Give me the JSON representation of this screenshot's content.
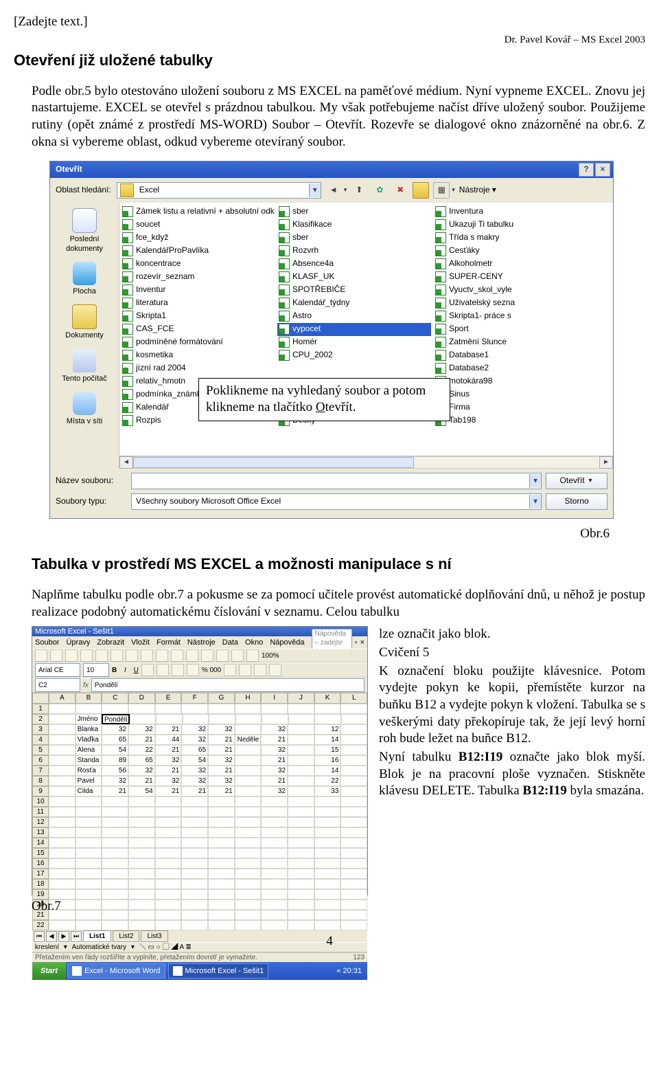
{
  "header": {
    "placeholder": "[Zadejte text.]",
    "author": "Dr. Pavel Kovář – MS Excel 2003"
  },
  "heading1": "Otevření již uložené tabulky",
  "para1": "Podle obr.5 bylo otestováno uložení souboru z MS EXCEL na paměťové médium. Nyní vypneme EXCEL. Znovu jej nastartujeme. EXCEL se otevřel s prázdnou tabulkou. My však potřebujeme načíst dříve uložený soubor. Použijeme rutiny (opět známé z prostředí MS-WORD) Soubor – Otevřít. Rozevře se dialogové okno znázorněné na obr.6. Z okna si vybereme oblast, odkud vybereme otevíraný soubor.",
  "dialog": {
    "title": "Otevřít",
    "searchLabel": "Oblast hledání:",
    "searchValue": "Excel",
    "toolsLabel": "Nástroje",
    "sidebar": [
      {
        "label": "Poslední dokumenty"
      },
      {
        "label": "Plocha"
      },
      {
        "label": "Dokumenty"
      },
      {
        "label": "Tento počítač"
      },
      {
        "label": "Místa v síti"
      }
    ],
    "col1": [
      "Zámek listu a relativní + absolutní odkazování",
      "soucet",
      "fce_když",
      "KalendářProPavlíka",
      "koncentrace",
      "rozevír_seznam",
      "Inventur",
      "literatura",
      "Skripta1",
      "CAS_FCE",
      "podmíněné formátování",
      "kosmetika",
      "jízní rad 2004",
      "relativ_hmotn",
      "podmínka_známky",
      "Kalendář",
      "Rozpis"
    ],
    "col2": [
      "sber",
      "Klasifikace",
      "sber",
      "Rozvrh",
      "Absence4a",
      "KLASF_UK",
      "SPOTŘEBIČE",
      "Kalendář_týdny",
      "Astro",
      "vypocet",
      "Homér",
      "CPU_2002",
      "",
      "",
      "",
      "",
      "Desky"
    ],
    "col2_selected_index": 9,
    "col3": [
      "Inventura",
      "Ukazuji Ti tabulku",
      "Třída s makry",
      "Cesťáky",
      "Alkoholmetr",
      "SUPER-CENY",
      "Vyuctv_skol_vyle",
      "Uživatelský sezna",
      "Skripta1- práce s",
      "Sport",
      "Zatmění Slunce",
      "Database1",
      "Database2",
      "motokára98",
      "Sinus",
      "Firma",
      "Tab198"
    ],
    "callout": "Poklikneme na vyhledaný soubor a potom klikneme na tlačítko Otevřít.",
    "nameLabel": "Název souboru:",
    "nameValue": "",
    "typeLabel": "Soubory typu:",
    "typeValue": "Všechny soubory Microsoft Office Excel",
    "openBtn": "Otevřít",
    "cancelBtn": "Storno"
  },
  "fig6": "Obr.6",
  "heading2": "Tabulka v prostředí MS EXCEL a možnosti manipulace s ní",
  "para2": "Naplňme tabulku podle obr.7 a pokusme se za pomocí učitele provést automatické doplňování dnů, u něhož je postup realizace podobný automatickému číslování v seznamu. Celou tabulku",
  "excel": {
    "title": "Microsoft Excel - Sešit1",
    "menu": [
      "Soubor",
      "Úpravy",
      "Zobrazit",
      "Vložit",
      "Formát",
      "Nástroje",
      "Data",
      "Okno",
      "Nápověda"
    ],
    "help": "Nápověda – zadejte dotaz",
    "font": "Arial CE",
    "size": "10",
    "namebox": "C2",
    "fxval": "Pondělí",
    "cols": [
      "A",
      "B",
      "C",
      "D",
      "E",
      "F",
      "G",
      "H",
      "I",
      "J",
      "K",
      "L"
    ],
    "rows": [
      [
        "",
        "",
        "",
        "",
        "",
        "",
        "",
        "",
        "",
        "",
        "",
        ""
      ],
      [
        "",
        "Jméno",
        "Pondělí",
        "",
        "",
        "",
        "",
        "",
        "",
        "",
        "",
        ""
      ],
      [
        "",
        "Blanka",
        "32",
        "32",
        "21",
        "32",
        "32",
        "",
        "32",
        "",
        "12",
        ""
      ],
      [
        "",
        "Vlaďka",
        "65",
        "21",
        "44",
        "32",
        "21",
        "Neděle",
        "21",
        "",
        "14",
        ""
      ],
      [
        "",
        "Alena",
        "54",
        "22",
        "21",
        "65",
        "21",
        "",
        "32",
        "",
        "15",
        ""
      ],
      [
        "",
        "Standa",
        "89",
        "65",
        "32",
        "54",
        "32",
        "",
        "21",
        "",
        "16",
        ""
      ],
      [
        "",
        "Rosťa",
        "56",
        "32",
        "21",
        "32",
        "21",
        "",
        "32",
        "",
        "14",
        ""
      ],
      [
        "",
        "Pavel",
        "32",
        "21",
        "32",
        "32",
        "32",
        "",
        "21",
        "",
        "22",
        ""
      ],
      [
        "",
        "Cilda",
        "21",
        "54",
        "21",
        "21",
        "21",
        "",
        "32",
        "",
        "33",
        ""
      ],
      [
        "",
        "",
        "",
        "",
        "",
        "",
        "",
        "",
        "",
        "",
        "",
        ""
      ],
      [
        "",
        "",
        "",
        "",
        "",
        "",
        "",
        "",
        "",
        "",
        "",
        ""
      ],
      [
        "",
        "",
        "",
        "",
        "",
        "",
        "",
        "",
        "",
        "",
        "",
        ""
      ],
      [
        "",
        "",
        "",
        "",
        "",
        "",
        "",
        "",
        "",
        "",
        "",
        ""
      ],
      [
        "",
        "",
        "",
        "",
        "",
        "",
        "",
        "",
        "",
        "",
        "",
        ""
      ],
      [
        "",
        "",
        "",
        "",
        "",
        "",
        "",
        "",
        "",
        "",
        "",
        ""
      ],
      [
        "",
        "",
        "",
        "",
        "",
        "",
        "",
        "",
        "",
        "",
        "",
        ""
      ],
      [
        "",
        "",
        "",
        "",
        "",
        "",
        "",
        "",
        "",
        "",
        "",
        ""
      ],
      [
        "",
        "",
        "",
        "",
        "",
        "",
        "",
        "",
        "",
        "",
        "",
        ""
      ],
      [
        "",
        "",
        "",
        "",
        "",
        "",
        "",
        "",
        "",
        "",
        "",
        ""
      ],
      [
        "",
        "",
        "",
        "",
        "",
        "",
        "",
        "",
        "",
        "",
        "",
        ""
      ],
      [
        "",
        "",
        "",
        "",
        "",
        "",
        "",
        "",
        "",
        "",
        "",
        ""
      ],
      [
        "",
        "",
        "",
        "",
        "",
        "",
        "",
        "",
        "",
        "",
        "",
        ""
      ]
    ],
    "sheets": [
      "List1",
      "List2",
      "List3"
    ],
    "draw": "kreslení",
    "autoshapes": "Automatické tvary",
    "status": "Přetažením ven řády rozšíříte a vyplníte, přetažením dovnitř je vymažete.",
    "statval": "123",
    "start": "Start",
    "app1": "Excel - Microsoft Word",
    "app2": "Microsoft Excel - Sešit1",
    "clock": "« 20:31"
  },
  "fig7": "Obr.7",
  "right": "lze označit jako blok.\nCvičení 5\nK označení bloku použijte klávesnice. Potom vydejte pokyn ke kopii, přemístěte kurzor na buňku B12 a vydejte pokyn k vložení. Tabulka se s veškerými daty překopíruje tak, že její levý horní roh bude ležet na buňce B12.\nNyní tabulku B12:I19 označte jako blok myší. Blok je na pracovní ploše vyznačen. Stiskněte klávesu DELETE. Tabulka B12:I19 byla smazána.",
  "pagenum": "4"
}
